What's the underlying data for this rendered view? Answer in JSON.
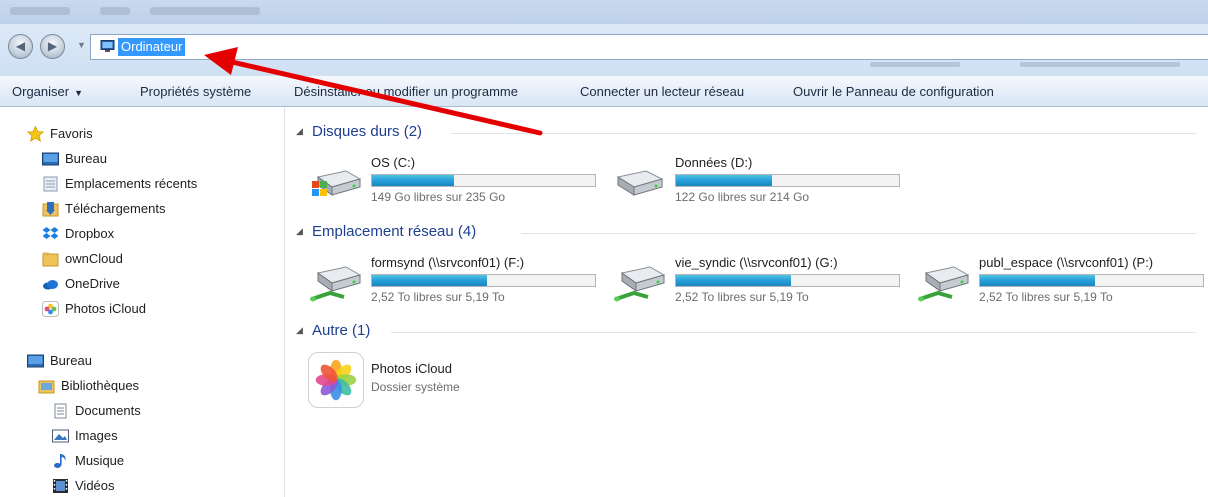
{
  "address": {
    "location": "Ordinateur"
  },
  "toolbar": {
    "organize": "Organiser",
    "system_properties": "Propriétés système",
    "uninstall": "Désinstaller ou modifier un programme",
    "map_drive": "Connecter un lecteur réseau",
    "control_panel": "Ouvrir le Panneau de configuration"
  },
  "sidebar": {
    "favorites": {
      "title": "Favoris",
      "items": [
        "Bureau",
        "Emplacements récents",
        "Téléchargements",
        "Dropbox",
        "ownCloud",
        "OneDrive",
        "Photos iCloud"
      ]
    },
    "desktop": {
      "title": "Bureau",
      "libraries": "Bibliothèques",
      "library_items": [
        "Documents",
        "Images",
        "Musique",
        "Vidéos"
      ]
    }
  },
  "groups": {
    "hard_drives": {
      "title": "Disques durs (2)",
      "items": [
        {
          "name": "OS (C:)",
          "free": "149 Go libres sur 235 Go",
          "used_fraction": 0.366
        },
        {
          "name": "Données (D:)",
          "free": "122 Go libres sur 214 Go",
          "used_fraction": 0.43
        }
      ]
    },
    "network": {
      "title": "Emplacement réseau (4)",
      "items": [
        {
          "name": "formsynd (\\\\srvconf01) (F:)",
          "free": "2,52 To libres sur 5,19 To",
          "used_fraction": 0.514
        },
        {
          "name": "vie_syndic (\\\\srvconf01) (G:)",
          "free": "2,52 To libres sur 5,19 To",
          "used_fraction": 0.514
        },
        {
          "name": "publ_espace (\\\\srvconf01) (P:)",
          "free": "2,52 To libres sur 5,19 To",
          "used_fraction": 0.514
        }
      ]
    },
    "other": {
      "title": "Autre (1)",
      "items": [
        {
          "name": "Photos iCloud",
          "type": "Dossier système"
        }
      ]
    }
  },
  "colors": {
    "accent": "#e50000",
    "bar": "#26a0da",
    "group_title": "#1e3f8f",
    "selection": "#3399ff"
  }
}
